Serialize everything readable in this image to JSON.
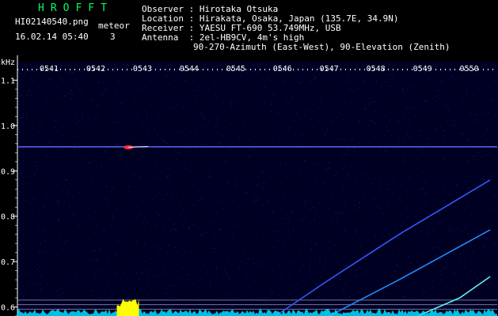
{
  "header": {
    "logo": "HROFFT",
    "filename": "HI02140540.png",
    "datetime": "16.02.14 05:40",
    "meteor_label": "meteor",
    "meteor_count": "3",
    "observer": "Observer : Hirotaka Otsuka",
    "location": "Location : Hirakata, Osaka, Japan (135.7E, 34.9N)",
    "receiver": "Receiver : YAESU FT-690 53.749MHz, USB",
    "antenna": "Antenna  : 2el-HB9CV, 4m's high",
    "antenna2": "90-270-Azimuth (East-West), 90-Elevation (Zenith)"
  },
  "chart_data": {
    "type": "heatmap",
    "ylabel": "kHz",
    "x_ticks": [
      "0541",
      "0542",
      "0543",
      "0544",
      "0545",
      "0546",
      "0547",
      "0548",
      "0549",
      "0550"
    ],
    "y_ticks": [
      1.1,
      1.0,
      0.9,
      0.8,
      0.7,
      0.6
    ],
    "ylim": [
      0.58,
      1.12
    ],
    "xlim": [
      0,
      10
    ],
    "carrier_khz": 0.953,
    "meteor_echoes": [
      {
        "time_min": 2.25,
        "freq_khz": 0.952,
        "duration_min": 0.4
      }
    ],
    "doppler_traces": [
      {
        "color": "#2f5bff",
        "points": [
          [
            5.35,
            0.58
          ],
          [
            6.5,
            0.66
          ],
          [
            8.0,
            0.76
          ],
          [
            9.95,
            0.88
          ]
        ]
      },
      {
        "color": "#1f8bff",
        "points": [
          [
            6.5,
            0.58
          ],
          [
            8.0,
            0.66
          ],
          [
            9.95,
            0.77
          ]
        ]
      },
      {
        "color": "#5ff0ff",
        "points": [
          [
            8.4,
            0.58
          ],
          [
            9.3,
            0.62
          ],
          [
            9.95,
            0.667
          ]
        ]
      }
    ],
    "colors": {
      "background": "#000022",
      "noise": "#2020a0",
      "carrier": "#6060ff",
      "meteor": "#ff3040",
      "floor": "#00e0ff",
      "burst": "#ffff00",
      "grid": "#9090c0"
    }
  }
}
